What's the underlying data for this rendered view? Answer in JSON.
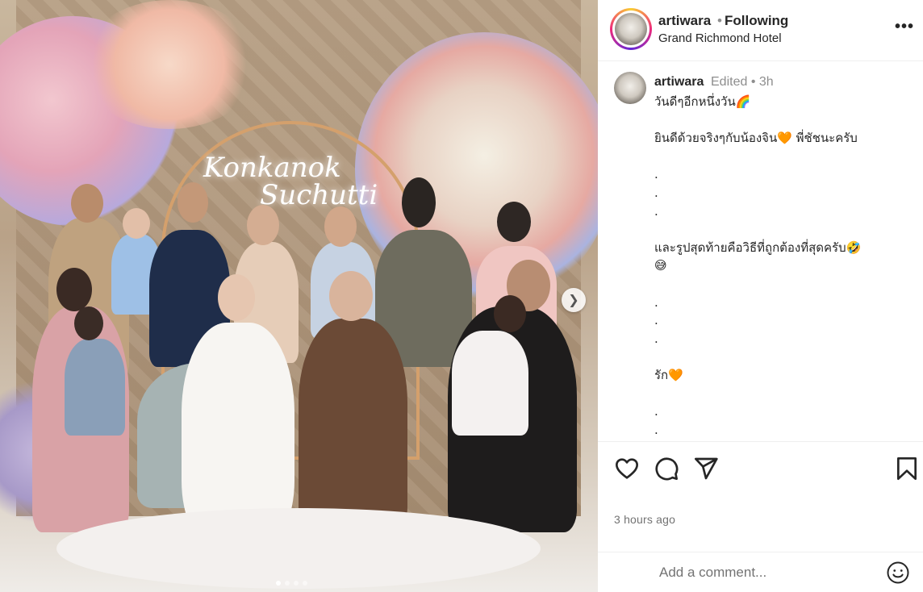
{
  "photo": {
    "neon_line1": "Konkanok",
    "neon_line2": "Suchutti",
    "carousel_dots": 4,
    "carousel_active_index": 0
  },
  "header": {
    "username": "artiwara",
    "separator": "•",
    "follow_status": "Following",
    "location": "Grand Richmond Hotel",
    "more_label": "•••"
  },
  "caption": {
    "username": "artiwara",
    "meta": "Edited  •  3h",
    "lines": [
      "วันดีๆอีกหนึ่งวัน🌈",
      "",
      "ยินดีด้วยจริงๆกับน้องจิน🧡 พี่ชัชนะครับ",
      "",
      ".",
      ".",
      ".",
      "",
      "และรูปสุดท้ายคือวิธีที่ถูกต้องที่สุดครับ🤣",
      "😅",
      "",
      ".",
      ".",
      ".",
      "",
      "รัก🧡",
      "",
      ".",
      "."
    ]
  },
  "actions": {
    "like_icon": "heart-icon",
    "comment_icon": "comment-icon",
    "share_icon": "share-icon",
    "save_icon": "bookmark-icon"
  },
  "timestamp": "3 hours ago",
  "comment": {
    "placeholder": "Add a comment...",
    "emoji_icon": "emoji-icon"
  }
}
